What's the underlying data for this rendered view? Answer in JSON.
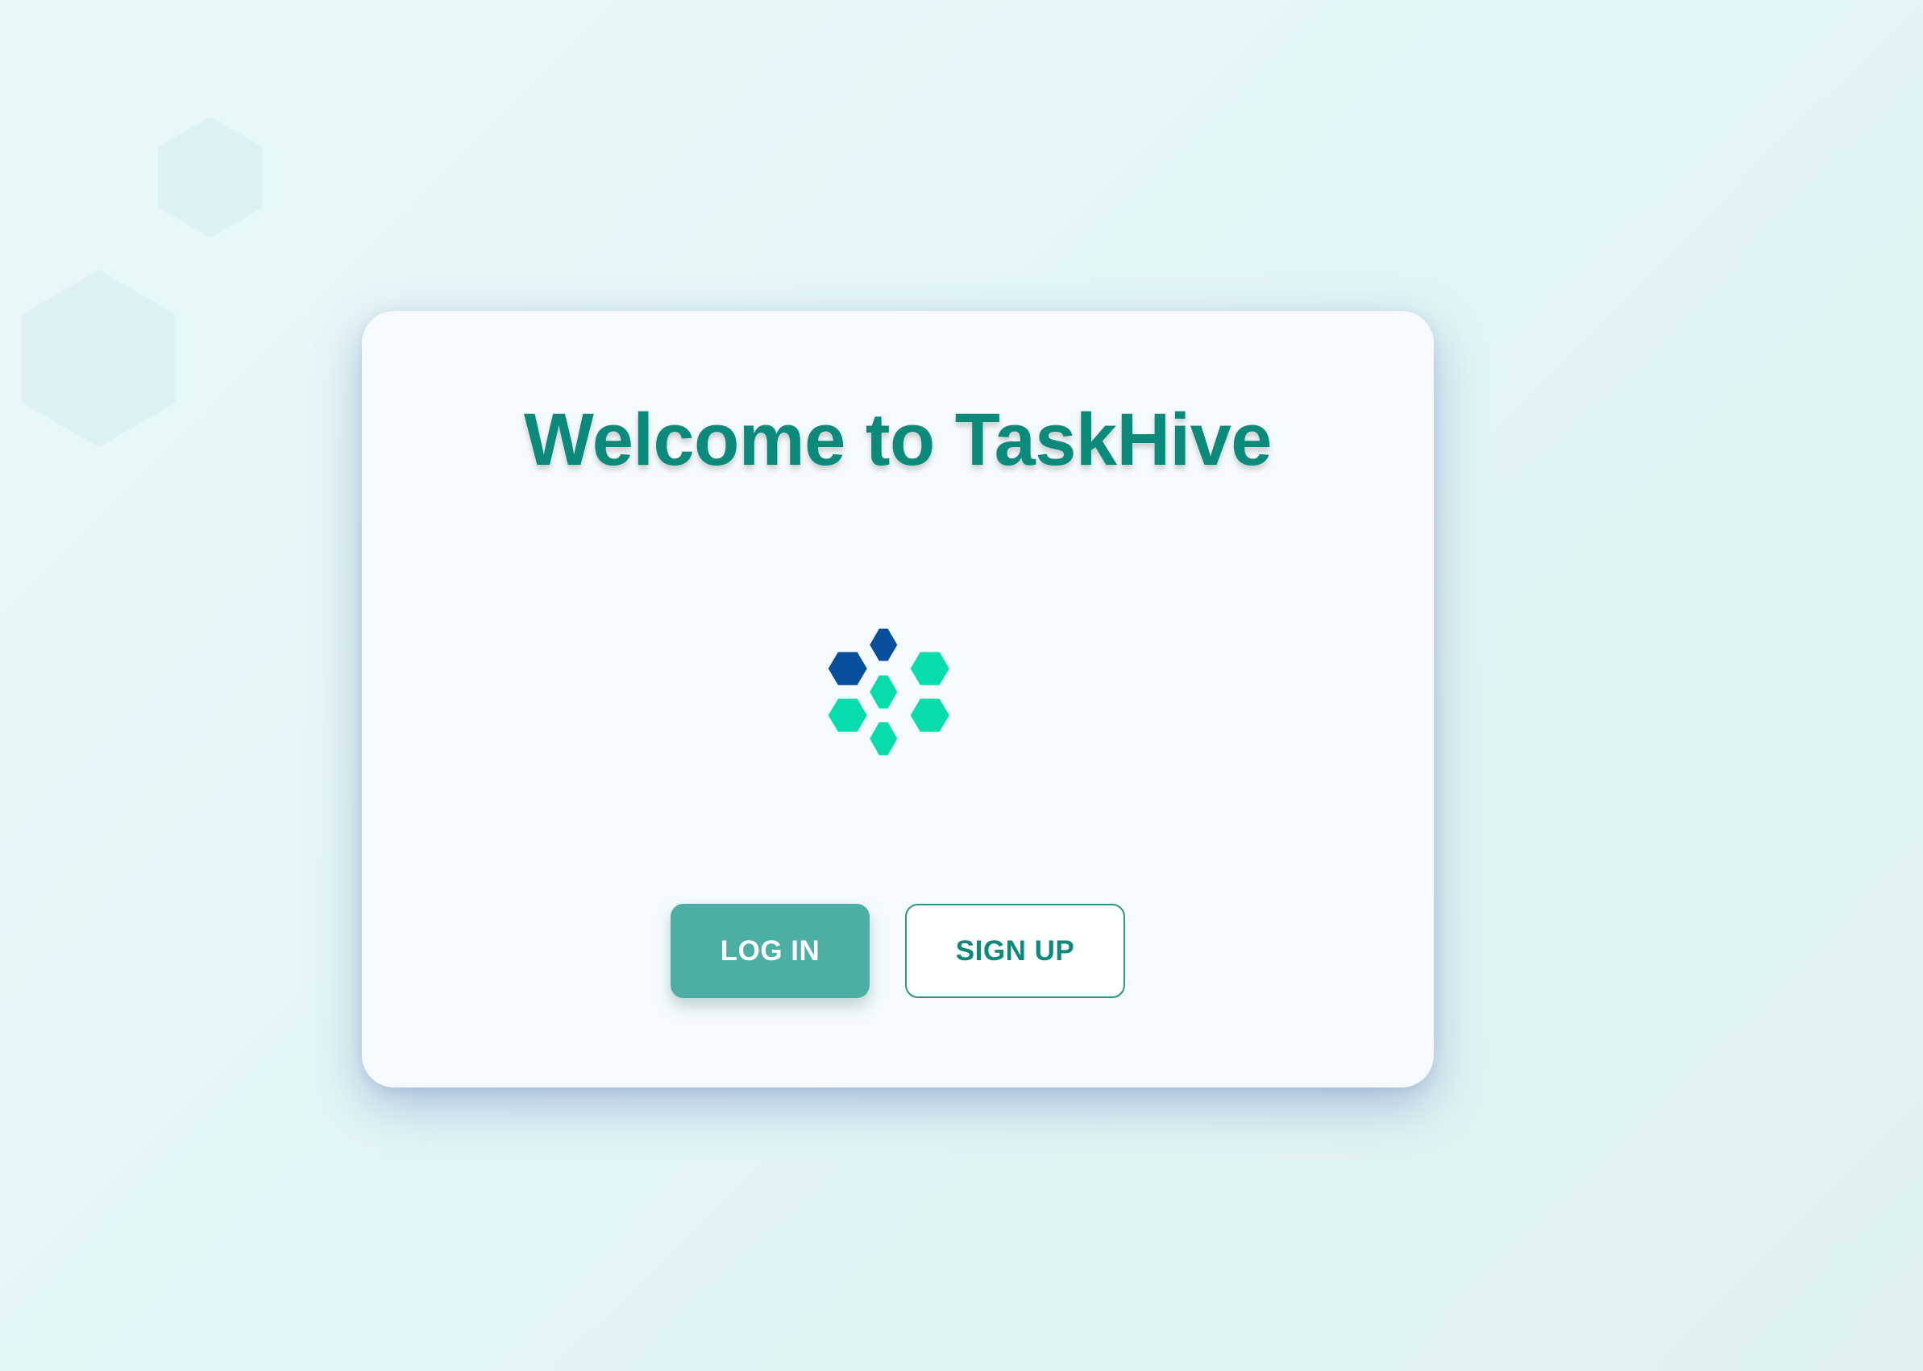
{
  "welcome": {
    "title": "Welcome to TaskHive",
    "logo": "honeycomb-logo-icon",
    "buttons": {
      "login_label": "LOG IN",
      "signup_label": "SIGN UP"
    }
  },
  "background": {
    "decoration": "hexagon-watermark-icon"
  },
  "colors": {
    "brand_teal": "#0b8a7c",
    "login_button": "#4daea3",
    "logo_navy": "#074f9c",
    "logo_mint": "#06dcac",
    "card_background": "#f5fbfc"
  }
}
